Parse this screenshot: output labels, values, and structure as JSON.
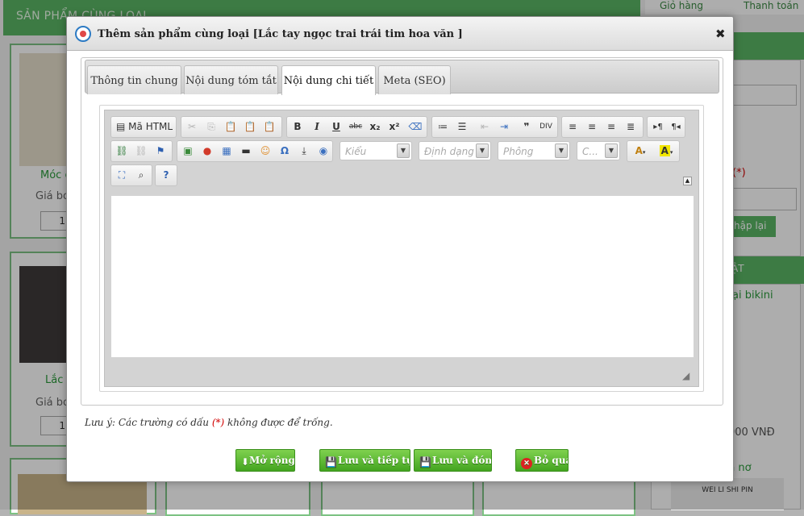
{
  "background": {
    "header_title": "SẢN PHẨM CÙNG LOẠI",
    "top_links": [
      "Giỏ hàng",
      "Thanh toán"
    ],
    "cards": [
      {
        "title": "Móc c",
        "price_label": "Giá bo",
        "qty": "1"
      },
      {
        "title": "Lắc",
        "price_label": "Giá bo",
        "qty": "1"
      }
    ],
    "side": {
      "required_mark": "(*)",
      "reset_label": "hập lại",
      "section_label": "ẬT",
      "product_name": "ại bikini",
      "product_price": "000 VNĐ",
      "more_label": "h nơ",
      "image_caption": "WEI LI SHI PIN"
    }
  },
  "dialog": {
    "title": "Thêm sản phẩm cùng loại [Lắc tay ngọc trai trái tim hoa văn ]",
    "close": "✖",
    "tabs": [
      {
        "label": "Thông tin chung",
        "active": false
      },
      {
        "label": "Nội dung tóm tắt",
        "active": false
      },
      {
        "label": "Nội dung chi tiết",
        "active": true
      },
      {
        "label": "Meta (SEO)",
        "active": false
      }
    ],
    "editor": {
      "source_label": "Mã HTML",
      "style_combo": "Kiểu",
      "format_combo": "Định dạng",
      "font_combo": "Phông",
      "size_combo": "C...",
      "content": ""
    },
    "note": {
      "prefix": "Lưu ý: Các trường có dấu ",
      "required": "(*)",
      "suffix": " không được để trống."
    },
    "buttons": {
      "expand": "Mở rộng",
      "save_continue": "Lưu và tiếp tục",
      "save_close": "Lưu và đóng",
      "skip": "Bỏ qua"
    }
  }
}
